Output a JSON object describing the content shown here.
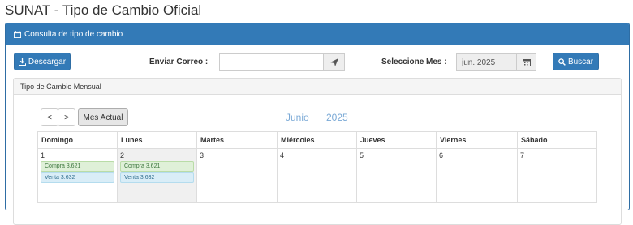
{
  "page": {
    "title": "SUNAT - Tipo de Cambio Oficial"
  },
  "panel": {
    "heading": "Consulta de tipo de cambio"
  },
  "toolbar": {
    "download_label": "Descargar",
    "email_label": "Enviar Correo :",
    "email_value": "",
    "email_placeholder": "",
    "month_label": "Seleccione Mes :",
    "month_value": "jun. 2025",
    "search_label": "Buscar"
  },
  "calendar": {
    "heading": "Tipo de Cambio Mensual",
    "prev": "<",
    "next": ">",
    "current_month_button": "Mes Actual",
    "month": "Junio",
    "year": "2025",
    "weekdays": [
      "Domingo",
      "Lunes",
      "Martes",
      "Miércoles",
      "Jueves",
      "Viernes",
      "Sábado"
    ],
    "days": [
      {
        "day": "1",
        "compra": "Compra 3.621",
        "venta": "Venta 3.632"
      },
      {
        "day": "2",
        "compra": "Compra 3.621",
        "venta": "Venta 3.632"
      },
      {
        "day": "3"
      },
      {
        "day": "4"
      },
      {
        "day": "5"
      },
      {
        "day": "6"
      },
      {
        "day": "7"
      }
    ]
  },
  "colors": {
    "primary": "#337ab7",
    "buy_bg": "#dff0d8",
    "sell_bg": "#d9edf7",
    "accent_text": "#7aa9d6"
  }
}
